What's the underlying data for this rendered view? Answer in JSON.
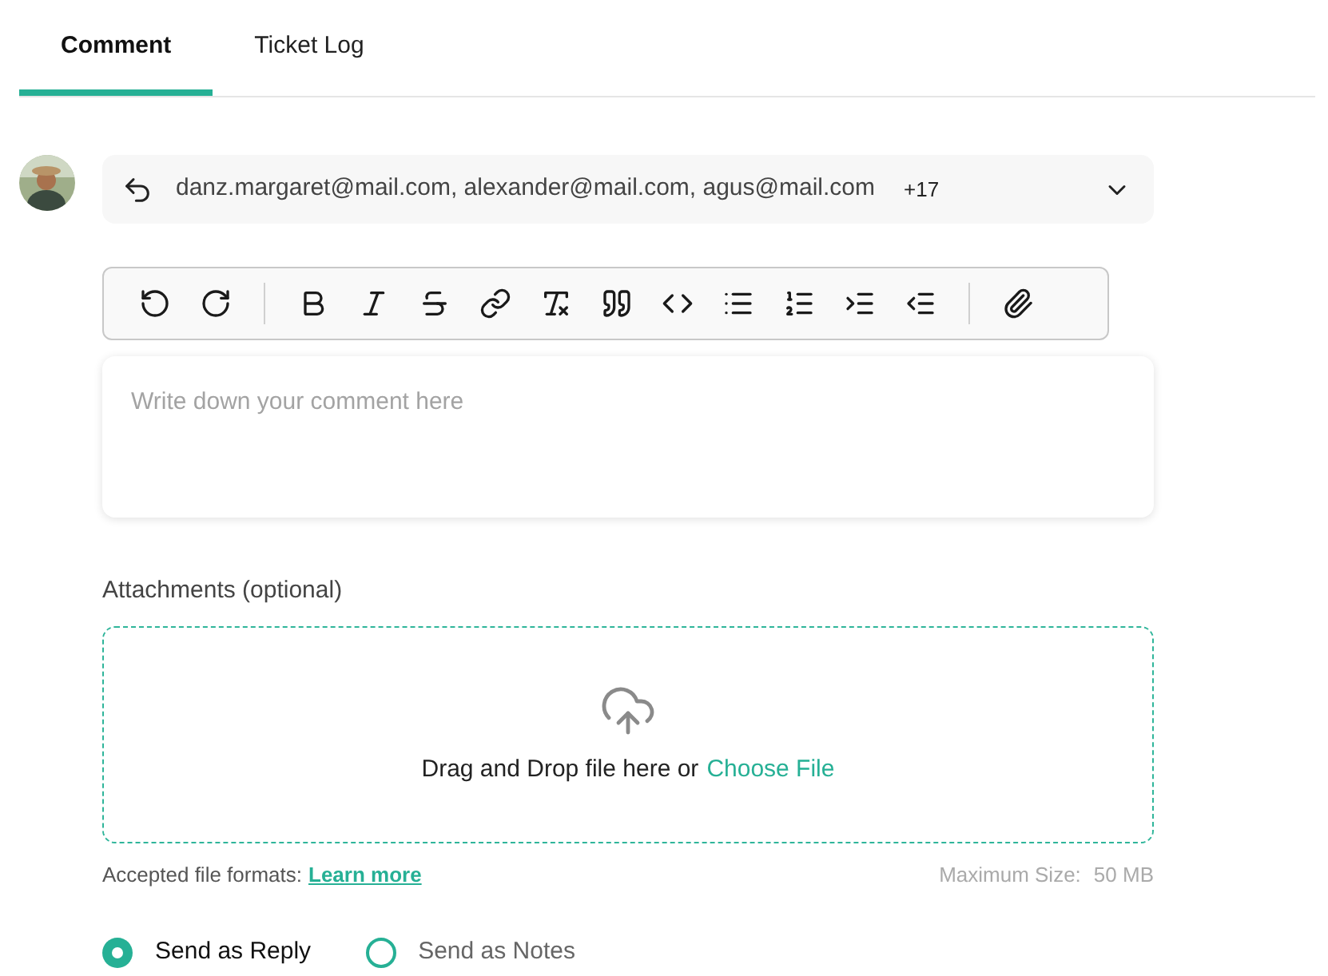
{
  "tabs": [
    {
      "label": "Comment",
      "selected": true
    },
    {
      "label": "Ticket Log",
      "selected": false
    }
  ],
  "recipients": {
    "text": "danz.margaret@mail.com, alexander@mail.com, agus@mail.com",
    "more": "+17"
  },
  "editor": {
    "placeholder": "Write down your comment here"
  },
  "attachments": {
    "label": "Attachments (optional)",
    "drop_text": "Drag and Drop file here or",
    "choose_link": "Choose File",
    "formats_label": "Accepted file formats:",
    "learn_more": "Learn more",
    "max_size_label": "Maximum Size:",
    "max_size": "50 MB"
  },
  "send_options": [
    {
      "label": "Send as Reply",
      "selected": true
    },
    {
      "label": "Send as Notes",
      "selected": false
    }
  ]
}
